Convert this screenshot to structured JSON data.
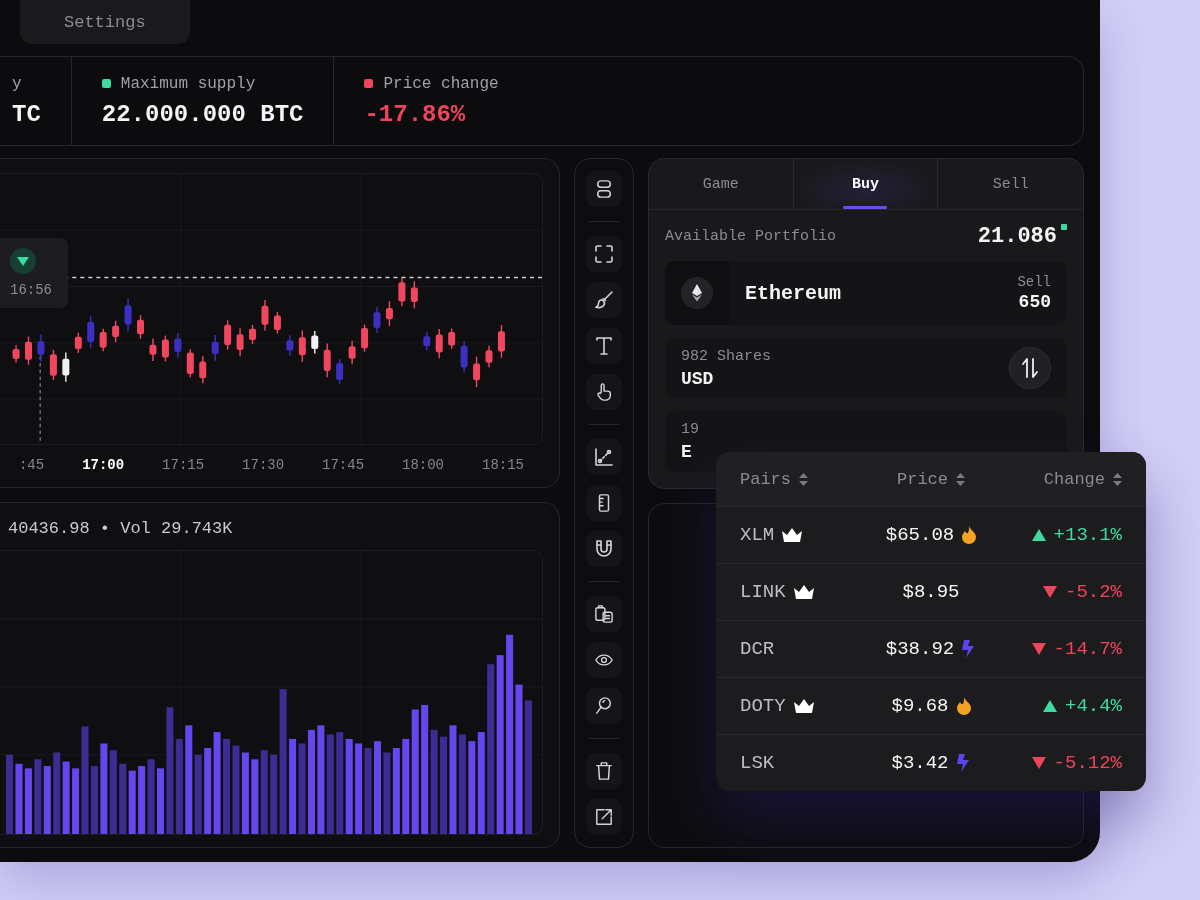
{
  "nav_tabs": [
    "Settings"
  ],
  "stats": [
    {
      "label": "y",
      "value": "TC",
      "negative": false
    },
    {
      "label": "Maximum supply",
      "value": "22.000.000 BTC",
      "color": "#3ddba0",
      "negative": false
    },
    {
      "label": "Price change",
      "value": "-17.86%",
      "color": "#f0445a",
      "negative": true
    }
  ],
  "price_chart": {
    "tooltip": {
      "time": "16:56"
    },
    "time_labels": [
      {
        "label": ":45",
        "selected": false
      },
      {
        "label": "17:00",
        "selected": true
      },
      {
        "label": "17:15",
        "selected": false
      },
      {
        "label": "17:30",
        "selected": false
      },
      {
        "label": "17:45",
        "selected": false
      },
      {
        "label": "18:00",
        "selected": false
      },
      {
        "label": "18:15",
        "selected": false
      }
    ]
  },
  "volume_chart": {
    "summary": "40436.98 • Vol 29.743K"
  },
  "trade": {
    "tabs": [
      {
        "label": "Game",
        "selected": false
      },
      {
        "label": "Buy",
        "selected": true
      },
      {
        "label": "Sell",
        "selected": false
      }
    ],
    "portfolio": {
      "label": "Available Portfolio",
      "value": "21.086",
      "live": true
    },
    "asset": {
      "name": "Ethereum",
      "side": "Sell",
      "amount": "650"
    },
    "exchange": [
      {
        "label": "982 Shares",
        "currency": "USD"
      },
      {
        "label": "19",
        "currency": "E"
      }
    ]
  },
  "pairs": {
    "columns": [
      "Pairs",
      "Price",
      "Change"
    ],
    "rows": [
      {
        "pair": "XLM",
        "crown": true,
        "price": "$65.08",
        "fire": true,
        "bolt": false,
        "change": "+13.1%",
        "rising": true
      },
      {
        "pair": "LINK",
        "crown": true,
        "price": "$8.95",
        "fire": false,
        "bolt": false,
        "change": "-5.2%",
        "rising": false
      },
      {
        "pair": "DCR",
        "crown": false,
        "price": "$38.92",
        "fire": false,
        "bolt": true,
        "change": "-14.7%",
        "rising": false
      },
      {
        "pair": "DOTY",
        "crown": true,
        "price": "$9.68",
        "fire": true,
        "bolt": false,
        "change": "+4.4%",
        "rising": true
      },
      {
        "pair": "LSK",
        "crown": false,
        "price": "$3.42",
        "fire": false,
        "bolt": true,
        "change": "-5.12%",
        "rising": false
      }
    ]
  }
}
